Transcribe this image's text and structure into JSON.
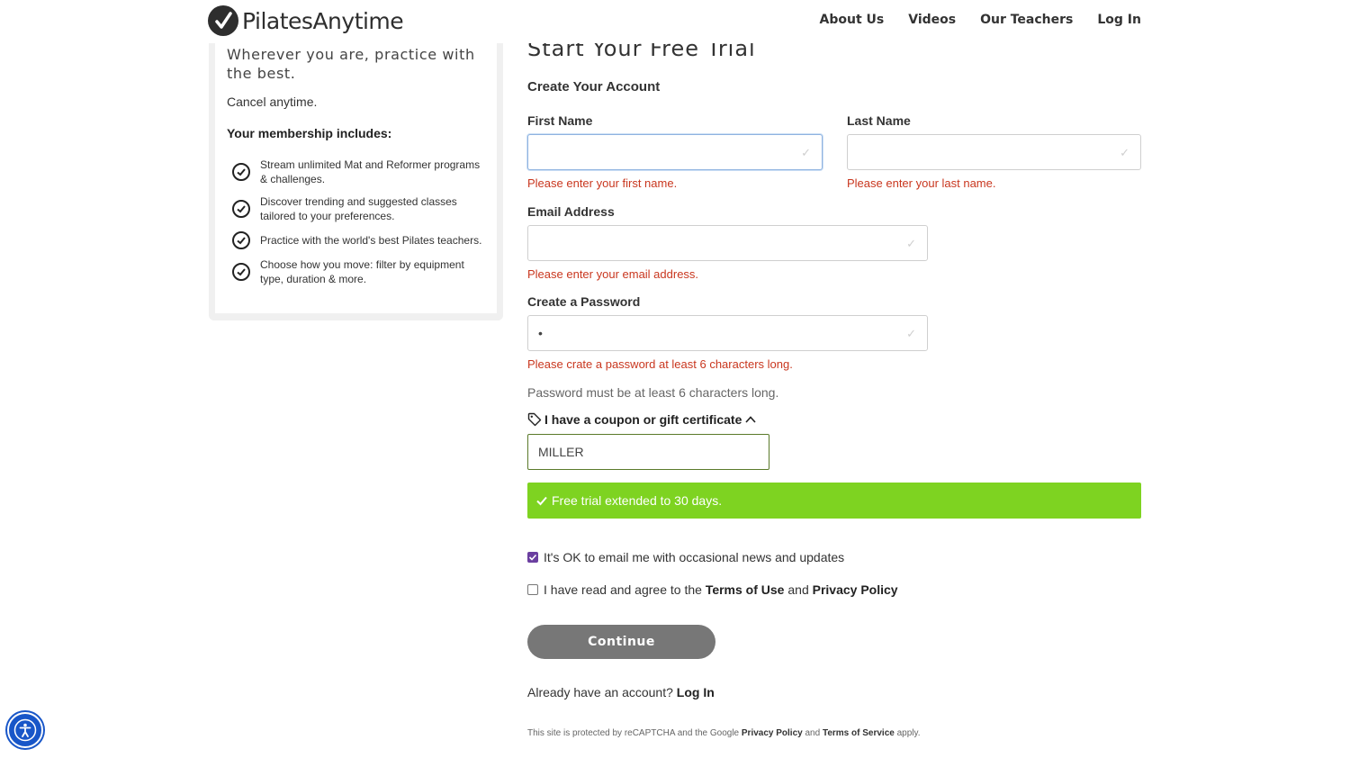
{
  "header": {
    "logo_text": "PilatesAnytime",
    "nav": [
      "About Us",
      "Videos",
      "Our Teachers",
      "Log In"
    ]
  },
  "sidebar": {
    "tagline": "Wherever you are, practice with the best.",
    "cancel": "Cancel anytime.",
    "includes_title": "Your membership includes:",
    "benefits": [
      "Stream unlimited Mat and Reformer programs & challenges.",
      "Discover trending and suggested classes tailored to your preferences.",
      "Practice with the world's best Pilates teachers.",
      "Choose how you move: filter by equipment type, duration & more."
    ]
  },
  "form": {
    "page_title": "Start Your Free Trial",
    "sub_title": "Create Your Account",
    "first_name": {
      "label": "First Name",
      "value": "",
      "error": "Please enter your first name."
    },
    "last_name": {
      "label": "Last Name",
      "value": "",
      "error": "Please enter your last name."
    },
    "email": {
      "label": "Email Address",
      "value": "",
      "error": "Please enter your email address."
    },
    "password": {
      "label": "Create a Password",
      "value": "•",
      "error": "Please crate a password at least 6 characters long.",
      "hint": "Password must be at least 6 characters long."
    },
    "coupon": {
      "toggle_label": "I have a coupon or gift certificate",
      "value": "MILLER",
      "success": "Free trial extended to 30 days."
    },
    "optin": {
      "label": "It's OK to email me with occasional news and updates",
      "checked": true
    },
    "terms": {
      "prefix": "I have read and agree to the ",
      "terms_link": "Terms of Use",
      "and": " and ",
      "privacy_link": "Privacy Policy",
      "checked": false
    },
    "continue_label": "Continue",
    "already_prefix": "Already have an account? ",
    "already_link": "Log In",
    "recaptcha": {
      "prefix": "This site is protected by reCAPTCHA and the Google ",
      "privacy": "Privacy Policy",
      "and": " and ",
      "terms": "Terms of Service",
      "suffix": " apply."
    }
  },
  "colors": {
    "accent_green": "#7ed321",
    "error_red": "#c9371f",
    "checkbox_purple": "#6b3fa0",
    "a11y_blue": "#1856c8"
  },
  "icons": [
    "logo-mark-icon",
    "check-circle-icon",
    "tag-icon",
    "chevron-up-icon",
    "checkmark-icon",
    "accessibility-icon"
  ]
}
